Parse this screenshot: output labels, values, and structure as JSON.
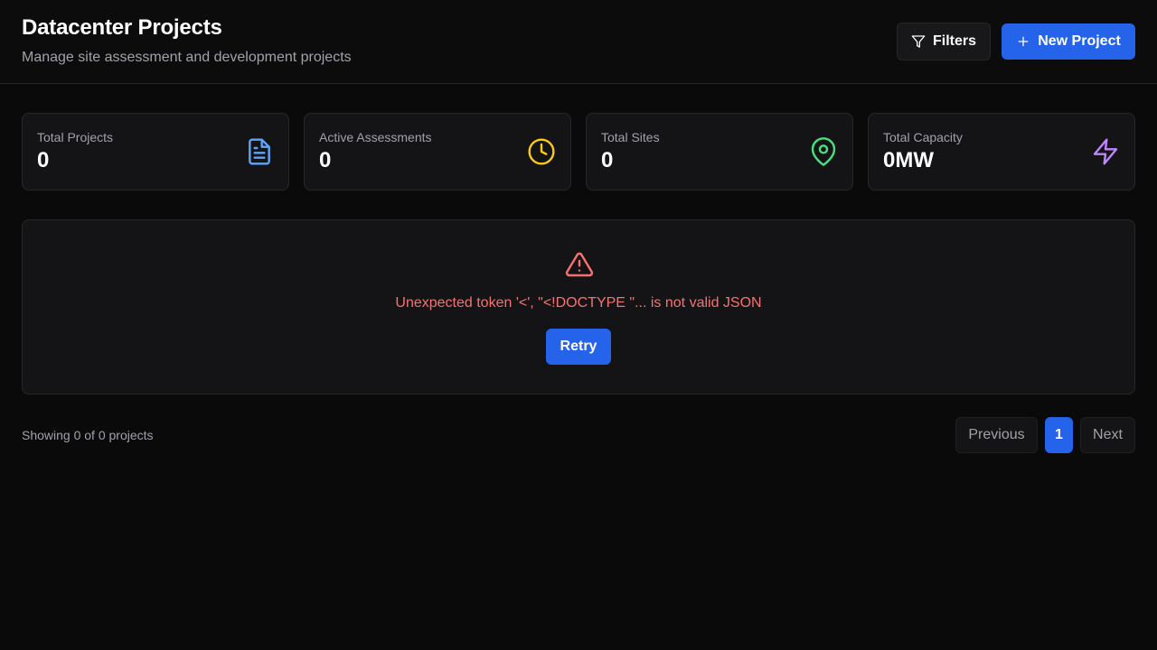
{
  "header": {
    "title": "Datacenter Projects",
    "subtitle": "Manage site assessment and development projects",
    "filters_label": "Filters",
    "new_project_label": "New Project"
  },
  "stats": [
    {
      "label": "Total Projects",
      "value": "0",
      "icon": "document-icon",
      "color": "#60a5fa"
    },
    {
      "label": "Active Assessments",
      "value": "0",
      "icon": "clock-icon",
      "color": "#facc15"
    },
    {
      "label": "Total Sites",
      "value": "0",
      "icon": "map-pin-icon",
      "color": "#4ade80"
    },
    {
      "label": "Total Capacity",
      "value": "0MW",
      "icon": "lightning-icon",
      "color": "#c084fc"
    }
  ],
  "error": {
    "message": "Unexpected token '<', \"<!DOCTYPE \"... is not valid JSON",
    "retry_label": "Retry",
    "icon": "warning-triangle-icon",
    "color": "#f87171"
  },
  "pagination": {
    "showing_text": "Showing 0 of 0 projects",
    "previous_label": "Previous",
    "current_page": "1",
    "next_label": "Next"
  },
  "colors": {
    "accent": "#2563eb",
    "background": "#0a0a0a",
    "card": "#141416",
    "border": "#27272a"
  }
}
